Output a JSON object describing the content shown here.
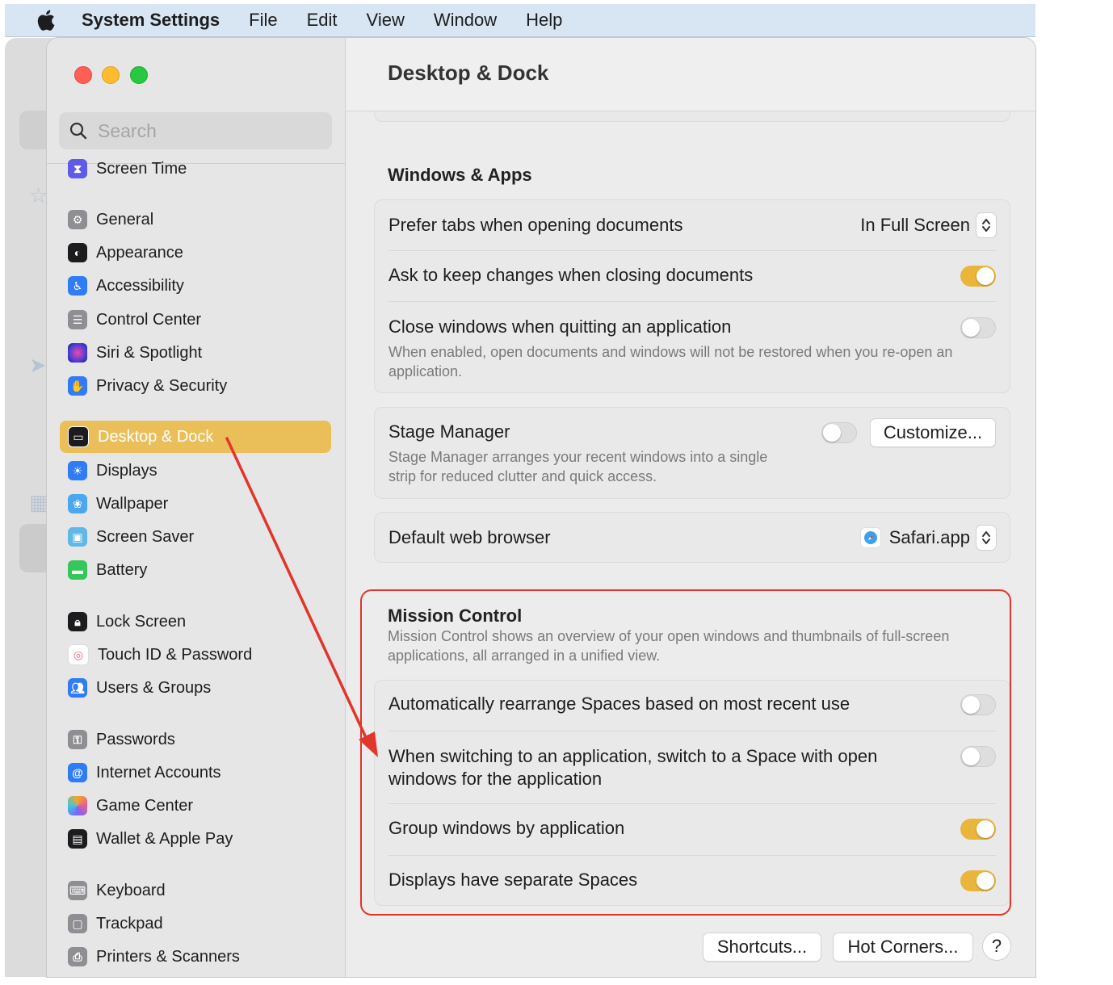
{
  "menubar": {
    "app_name": "System Settings",
    "items": [
      "File",
      "Edit",
      "View",
      "Window",
      "Help"
    ]
  },
  "sidebar": {
    "search_placeholder": "Search",
    "items": [
      {
        "label": "Screen Time",
        "icon": "hourglass-icon",
        "color": "#5e5ce6"
      },
      {
        "label": "General",
        "icon": "gear-icon",
        "color": "#8e8e93"
      },
      {
        "label": "Appearance",
        "icon": "appearance-icon",
        "color": "#1c1c1e"
      },
      {
        "label": "Accessibility",
        "icon": "accessibility-icon",
        "color": "#2f7cf6"
      },
      {
        "label": "Control Center",
        "icon": "control-center-icon",
        "color": "#8e8e93"
      },
      {
        "label": "Siri & Spotlight",
        "icon": "siri-icon",
        "color": "#7b3fe4"
      },
      {
        "label": "Privacy & Security",
        "icon": "hand-icon",
        "color": "#2f7cf6"
      },
      {
        "label": "Desktop & Dock",
        "icon": "dock-icon",
        "color": "#1c1c1e",
        "selected": true
      },
      {
        "label": "Displays",
        "icon": "sun-icon",
        "color": "#2f7cf6"
      },
      {
        "label": "Wallpaper",
        "icon": "flower-icon",
        "color": "#4aa8f0"
      },
      {
        "label": "Screen Saver",
        "icon": "screen-saver-icon",
        "color": "#5fb8e6"
      },
      {
        "label": "Battery",
        "icon": "battery-icon",
        "color": "#34c759"
      },
      {
        "label": "Lock Screen",
        "icon": "lock-icon",
        "color": "#1c1c1e"
      },
      {
        "label": "Touch ID & Password",
        "icon": "fingerprint-icon",
        "color": "#e8667a"
      },
      {
        "label": "Users & Groups",
        "icon": "users-icon",
        "color": "#2f7cf6"
      },
      {
        "label": "Passwords",
        "icon": "key-icon",
        "color": "#8e8e93"
      },
      {
        "label": "Internet Accounts",
        "icon": "at-icon",
        "color": "#2f7cf6"
      },
      {
        "label": "Game Center",
        "icon": "game-center-icon",
        "color": "#e35d9b"
      },
      {
        "label": "Wallet & Apple Pay",
        "icon": "wallet-icon",
        "color": "#1c1c1e"
      },
      {
        "label": "Keyboard",
        "icon": "keyboard-icon",
        "color": "#8e8e93"
      },
      {
        "label": "Trackpad",
        "icon": "trackpad-icon",
        "color": "#8e8e93"
      },
      {
        "label": "Printers & Scanners",
        "icon": "printer-icon",
        "color": "#8e8e93"
      }
    ]
  },
  "content": {
    "title": "Desktop & Dock",
    "windows_apps": {
      "title": "Windows & Apps",
      "prefer_tabs_label": "Prefer tabs when opening documents",
      "prefer_tabs_value": "In Full Screen",
      "ask_keep_label": "Ask to keep changes when closing documents",
      "ask_keep_on": true,
      "close_windows_label": "Close windows when quitting an application",
      "close_windows_desc": "When enabled, open documents and windows will not be restored when you re-open an application.",
      "close_windows_on": false
    },
    "stage_manager": {
      "label": "Stage Manager",
      "desc": "Stage Manager arranges your recent windows into a single strip for reduced clutter and quick access.",
      "on": false,
      "customize_label": "Customize..."
    },
    "browser": {
      "label": "Default web browser",
      "value": "Safari.app",
      "icon": "safari-icon"
    },
    "mission_control": {
      "title": "Mission Control",
      "desc": "Mission Control shows an overview of your open windows and thumbnails of full-screen applications, all arranged in a unified view.",
      "auto_rearrange_label": "Automatically rearrange Spaces based on most recent use",
      "auto_rearrange_on": false,
      "switch_space_label": "When switching to an application, switch to a Space with open windows for the application",
      "switch_space_on": false,
      "group_windows_label": "Group windows by application",
      "group_windows_on": true,
      "separate_spaces_label": "Displays have separate Spaces",
      "separate_spaces_on": true
    },
    "footer": {
      "shortcuts_label": "Shortcuts...",
      "hot_corners_label": "Hot Corners...",
      "help_label": "?"
    }
  },
  "colors": {
    "accent": "#e9b53b",
    "selection": "#eabf5a",
    "annotation": "#e2352b"
  }
}
